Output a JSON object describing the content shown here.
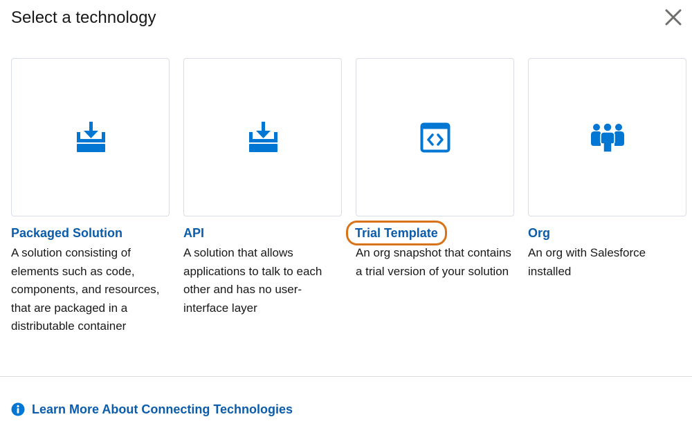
{
  "modal": {
    "title": "Select a technology",
    "close_icon": "close-icon"
  },
  "cards": [
    {
      "title": "Packaged Solution",
      "description": "A solution consisting of elements such as code, components, and resources, that are packaged in a distributable container",
      "icon": "download-tray-icon"
    },
    {
      "title": "API",
      "description": "A solution that allows applications to talk to each other and has no user-interface layer",
      "icon": "download-tray-icon"
    },
    {
      "title": "Trial Template",
      "description": "An org snapshot that contains a trial version of your solution",
      "icon": "code-window-icon"
    },
    {
      "title": "Org",
      "description": "An org with Salesforce installed",
      "icon": "people-group-icon"
    }
  ],
  "footer": {
    "learn_more_label": "Learn More About Connecting Technologies",
    "icon": "info-icon"
  },
  "colors": {
    "accent": "#0b5cab",
    "icon_blue": "#0176d3",
    "highlight": "#d9731a",
    "border": "#d8dde6"
  }
}
